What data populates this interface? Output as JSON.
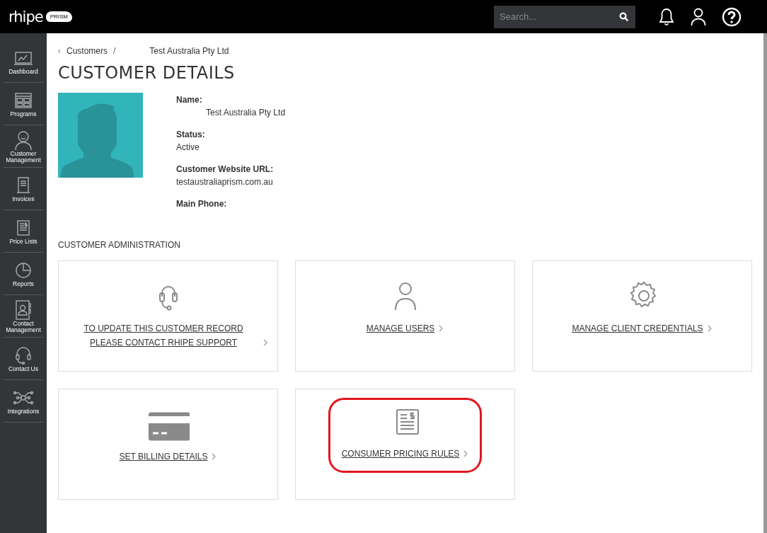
{
  "header": {
    "logo": "rhipe",
    "logo_badge": "PRISM",
    "search": {
      "placeholder": "Search..."
    }
  },
  "sidebar": {
    "items": [
      {
        "kind": "dashboard",
        "label": "Dashboard"
      },
      {
        "kind": "programs",
        "label": "Programs"
      },
      {
        "kind": "customer",
        "label": "Customer Management"
      },
      {
        "kind": "invoices",
        "label": "Invoices"
      },
      {
        "kind": "pricelists",
        "label": "Price Lists"
      },
      {
        "kind": "reports",
        "label": "Reports"
      },
      {
        "kind": "contacts",
        "label": "Contact Management"
      },
      {
        "kind": "support",
        "label": "Contact Us"
      },
      {
        "kind": "integrations",
        "label": "Integrations"
      }
    ]
  },
  "breadcrumb": {
    "back": "‹",
    "parent": "Customers",
    "separator": "/",
    "current": "Test Australia Pty Ltd"
  },
  "title": "CUSTOMER DETAILS",
  "details": [
    {
      "label": "Name:",
      "value": "Test Australia Pty Ltd",
      "indented": true
    },
    {
      "label": "Status:",
      "value": "Active",
      "indented": false
    },
    {
      "label": "Customer Website URL:",
      "value": "testaustraliaprism.com.au",
      "indented": false
    },
    {
      "label": "Main Phone:"
    }
  ],
  "admin": {
    "heading": "CUSTOMER ADMINISTRATION",
    "cards": [
      {
        "kind": "support",
        "label": "TO UPDATE THIS CUSTOMER RECORD PLEASE CONTACT RHIPE SUPPORT",
        "highlighted": false
      },
      {
        "kind": "users",
        "label": "MANAGE USERS",
        "highlighted": false
      },
      {
        "kind": "credentials",
        "label": "MANAGE CLIENT CREDENTIALS",
        "highlighted": false
      },
      {
        "kind": "billing",
        "label": "SET BILLING DETAILS",
        "highlighted": false
      },
      {
        "kind": "pricing",
        "label": "CONSUMER PRICING RULES",
        "highlighted": true
      }
    ]
  }
}
